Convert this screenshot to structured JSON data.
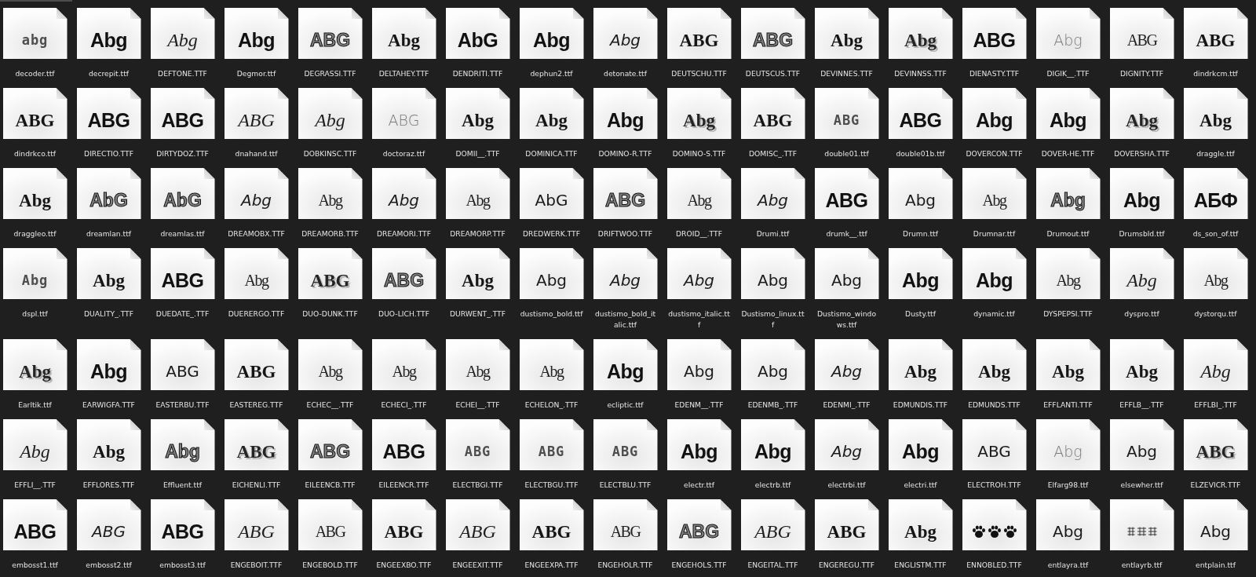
{
  "files": [
    {
      "name": "decoder.ttf",
      "preview": "abg",
      "kind": "dotted"
    },
    {
      "name": "decrepit.ttf",
      "preview": "Abg",
      "kind": "heavy"
    },
    {
      "name": "DEFTONE.TTF",
      "preview": "Abg",
      "kind": "script"
    },
    {
      "name": "Degmor.ttf",
      "preview": "Abg",
      "kind": "heavy"
    },
    {
      "name": "DEGRASSI.TTF",
      "preview": "ABG",
      "kind": "outline"
    },
    {
      "name": "DELTAHEY.TTF",
      "preview": "Abg",
      "kind": "serif"
    },
    {
      "name": "DENDRITI.TTF",
      "preview": "AbG",
      "kind": "heavy"
    },
    {
      "name": "dephun2.ttf",
      "preview": "Abg",
      "kind": "heavy"
    },
    {
      "name": "detonate.ttf",
      "preview": "Abg",
      "kind": "italic"
    },
    {
      "name": "DEUTSCHU.TTF",
      "preview": "ABG",
      "kind": "serif"
    },
    {
      "name": "DEUTSCUS.TTF",
      "preview": "ABG",
      "kind": "outline"
    },
    {
      "name": "DEVINNES.TTF",
      "preview": "Abg",
      "kind": "serif"
    },
    {
      "name": "DEVINNSS.TTF",
      "preview": "Abg",
      "kind": "shadow"
    },
    {
      "name": "DIENASTY.TTF",
      "preview": "ABG",
      "kind": "heavy"
    },
    {
      "name": "DIGIK__.TTF",
      "preview": "Abg",
      "kind": "light"
    },
    {
      "name": "DIGNITY.TTF",
      "preview": "ABG",
      "kind": "condensed"
    },
    {
      "name": "dindrkcm.ttf",
      "preview": "ABG",
      "kind": "serif"
    },
    {
      "name": "dindrkco.ttf",
      "preview": "ABG",
      "kind": "serif"
    },
    {
      "name": "DIRECTIO.TTF",
      "preview": "ABG",
      "kind": "heavy"
    },
    {
      "name": "DIRTYDOZ.TTF",
      "preview": "ABG",
      "kind": "heavy"
    },
    {
      "name": "dnahand.ttf",
      "preview": "ABG",
      "kind": "script"
    },
    {
      "name": "DOBKINSC.TTF",
      "preview": "Abg",
      "kind": "script"
    },
    {
      "name": "doctoraz.ttf",
      "preview": "ABG",
      "kind": "light"
    },
    {
      "name": "DOMII__.TTF",
      "preview": "Abg",
      "kind": "serif"
    },
    {
      "name": "DOMINICA.TTF",
      "preview": "Abg",
      "kind": "serif"
    },
    {
      "name": "DOMINO-R.TTF",
      "preview": "Abg",
      "kind": "heavy"
    },
    {
      "name": "DOMINO-S.TTF",
      "preview": "Abg",
      "kind": "shadow"
    },
    {
      "name": "DOMISC_.TTF",
      "preview": "ABG",
      "kind": "serif"
    },
    {
      "name": "double01.ttf",
      "preview": "ABG",
      "kind": "dotted"
    },
    {
      "name": "double01b.ttf",
      "preview": "ABG",
      "kind": "heavy"
    },
    {
      "name": "DOVERCON.TTF",
      "preview": "Abg",
      "kind": "heavy"
    },
    {
      "name": "DOVER-HE.TTF",
      "preview": "Abg",
      "kind": "heavy"
    },
    {
      "name": "DOVERSHA.TTF",
      "preview": "Abg",
      "kind": "shadow"
    },
    {
      "name": "draggle.ttf",
      "preview": "Abg",
      "kind": "serif"
    },
    {
      "name": "draggleo.ttf",
      "preview": "Abg",
      "kind": "serif"
    },
    {
      "name": "dreamlan.ttf",
      "preview": "AbG",
      "kind": "outline"
    },
    {
      "name": "dreamlas.ttf",
      "preview": "AbG",
      "kind": "outline"
    },
    {
      "name": "DREAMOBX.TTF",
      "preview": "Abg",
      "kind": "italic"
    },
    {
      "name": "DREAMORB.TTF",
      "preview": "Abg",
      "kind": "condensed"
    },
    {
      "name": "DREAMORI.TTF",
      "preview": "Abg",
      "kind": "italic"
    },
    {
      "name": "DREAMORP.TTF",
      "preview": "Abg",
      "kind": "condensed"
    },
    {
      "name": "DREDWERK.TTF",
      "preview": "AbG",
      "kind": "sans"
    },
    {
      "name": "DRIFTWOO.TTF",
      "preview": "ABG",
      "kind": "outline"
    },
    {
      "name": "DROID__.TTF",
      "preview": "Abg",
      "kind": "condensed"
    },
    {
      "name": "Drumi.ttf",
      "preview": "Abg",
      "kind": "italic"
    },
    {
      "name": "drumk__.ttf",
      "preview": "ABG",
      "kind": "heavy"
    },
    {
      "name": "Drumn.ttf",
      "preview": "Abg",
      "kind": "sans"
    },
    {
      "name": "Drumnar.ttf",
      "preview": "Abg",
      "kind": "condensed"
    },
    {
      "name": "Drumout.ttf",
      "preview": "Abg",
      "kind": "outline"
    },
    {
      "name": "Drumsbld.ttf",
      "preview": "Abg",
      "kind": "heavy"
    },
    {
      "name": "ds_son_of.ttf",
      "preview": "АБФ",
      "kind": "heavy"
    },
    {
      "name": "dspl.ttf",
      "preview": "Abg",
      "kind": "dotted"
    },
    {
      "name": "DUALITY_.TTF",
      "preview": "Abg",
      "kind": "serif"
    },
    {
      "name": "DUEDATE_.TTF",
      "preview": "ABG",
      "kind": "heavy"
    },
    {
      "name": "DUERERGO.TTF",
      "preview": "Abg",
      "kind": "condensed"
    },
    {
      "name": "DUO-DUNK.TTF",
      "preview": "ABG",
      "kind": "shadow"
    },
    {
      "name": "DUO-LICH.TTF",
      "preview": "ABG",
      "kind": "outline"
    },
    {
      "name": "DURWENT_.TTF",
      "preview": "Abg",
      "kind": "serif"
    },
    {
      "name": "dustismo_bold.ttf",
      "preview": "Abg",
      "kind": "sans"
    },
    {
      "name": "dustismo_bold_italic.ttf",
      "preview": "Abg",
      "kind": "italic"
    },
    {
      "name": "dustismo_italic.ttf",
      "preview": "Abg",
      "kind": "italic"
    },
    {
      "name": "Dustismo_linux.ttf",
      "preview": "Abg",
      "kind": "sans"
    },
    {
      "name": "Dustismo_windows.ttf",
      "preview": "Abg",
      "kind": "sans"
    },
    {
      "name": "Dusty.ttf",
      "preview": "Abg",
      "kind": "heavy"
    },
    {
      "name": "dynamic.ttf",
      "preview": "Abg",
      "kind": "heavy"
    },
    {
      "name": "DYSPEPSI.TTF",
      "preview": "Abg",
      "kind": "condensed"
    },
    {
      "name": "dyspro.ttf",
      "preview": "Abg",
      "kind": "script"
    },
    {
      "name": "dystorqu.ttf",
      "preview": "Abg",
      "kind": "condensed"
    },
    {
      "name": "Earltik.ttf",
      "preview": "Abg",
      "kind": "shadow"
    },
    {
      "name": "EARWIGFA.TTF",
      "preview": "Abg",
      "kind": "heavy"
    },
    {
      "name": "EASTERBU.TTF",
      "preview": "ABG",
      "kind": "sans"
    },
    {
      "name": "EASTEREG.TTF",
      "preview": "ABG",
      "kind": "serif"
    },
    {
      "name": "ECHEC__.TTF",
      "preview": "Abg",
      "kind": "condensed"
    },
    {
      "name": "ECHECI_.TTF",
      "preview": "Abg",
      "kind": "condensed"
    },
    {
      "name": "ECHEI__.TTF",
      "preview": "Abg",
      "kind": "condensed"
    },
    {
      "name": "ECHELON_.TTF",
      "preview": "Abg",
      "kind": "condensed"
    },
    {
      "name": "ecliptic.ttf",
      "preview": "Abg",
      "kind": "heavy"
    },
    {
      "name": "EDENM__.TTF",
      "preview": "Abg",
      "kind": "sans"
    },
    {
      "name": "EDENMB_.TTF",
      "preview": "Abg",
      "kind": "sans"
    },
    {
      "name": "EDENMI_.TTF",
      "preview": "Abg",
      "kind": "italic"
    },
    {
      "name": "EDMUNDIS.TTF",
      "preview": "Abg",
      "kind": "serif"
    },
    {
      "name": "EDMUNDS.TTF",
      "preview": "Abg",
      "kind": "serif"
    },
    {
      "name": "EFFLANTI.TTF",
      "preview": "Abg",
      "kind": "serif"
    },
    {
      "name": "EFFLB__.TTF",
      "preview": "Abg",
      "kind": "serif"
    },
    {
      "name": "EFFLBI_.TTF",
      "preview": "Abg",
      "kind": "script"
    },
    {
      "name": "EFFLI__.TTF",
      "preview": "Abg",
      "kind": "script"
    },
    {
      "name": "EFFLORES.TTF",
      "preview": "Abg",
      "kind": "serif"
    },
    {
      "name": "Effluent.ttf",
      "preview": "Abg",
      "kind": "outline"
    },
    {
      "name": "EICHENLI.TTF",
      "preview": "ABG",
      "kind": "shadow"
    },
    {
      "name": "EILEENCB.TTF",
      "preview": "ABG",
      "kind": "outline"
    },
    {
      "name": "EILEENCR.TTF",
      "preview": "ABG",
      "kind": "heavy"
    },
    {
      "name": "ELECTBGI.TTF",
      "preview": "ABG",
      "kind": "dotted"
    },
    {
      "name": "ELECTBGU.TTF",
      "preview": "ABG",
      "kind": "dotted"
    },
    {
      "name": "ELECTBLU.TTF",
      "preview": "ABG",
      "kind": "dotted"
    },
    {
      "name": "electr.ttf",
      "preview": "Abg",
      "kind": "heavy"
    },
    {
      "name": "electrb.ttf",
      "preview": "Abg",
      "kind": "heavy"
    },
    {
      "name": "electrbi.ttf",
      "preview": "Abg",
      "kind": "italic"
    },
    {
      "name": "electri.ttf",
      "preview": "Abg",
      "kind": "heavy"
    },
    {
      "name": "ELECTROH.TTF",
      "preview": "ABG",
      "kind": "sans"
    },
    {
      "name": "Elfarg98.ttf",
      "preview": "Abg",
      "kind": "light"
    },
    {
      "name": "elsewher.ttf",
      "preview": "Abg",
      "kind": "sans"
    },
    {
      "name": "ELZEVICR.TTF",
      "preview": "ABG",
      "kind": "shadow"
    },
    {
      "name": "embosst1.ttf",
      "preview": "ABG",
      "kind": "heavy"
    },
    {
      "name": "embosst2.ttf",
      "preview": "ABG",
      "kind": "italic"
    },
    {
      "name": "embosst3.ttf",
      "preview": "ABG",
      "kind": "heavy"
    },
    {
      "name": "ENGEBOIT.TTF",
      "preview": "ABG",
      "kind": "script"
    },
    {
      "name": "ENGEBOLD.TTF",
      "preview": "ABG",
      "kind": "condensed"
    },
    {
      "name": "ENGEEXBO.TTF",
      "preview": "ABG",
      "kind": "serif"
    },
    {
      "name": "ENGEEXIT.TTF",
      "preview": "ABG",
      "kind": "script"
    },
    {
      "name": "ENGEEXPA.TTF",
      "preview": "ABG",
      "kind": "serif"
    },
    {
      "name": "ENGEHOLR.TTF",
      "preview": "ABG",
      "kind": "condensed"
    },
    {
      "name": "ENGEHOLS.TTF",
      "preview": "ABG",
      "kind": "outline"
    },
    {
      "name": "ENGEITAL.TTF",
      "preview": "ABG",
      "kind": "script"
    },
    {
      "name": "ENGEREGU.TTF",
      "preview": "ABG",
      "kind": "serif"
    },
    {
      "name": "ENGLISTM.TTF",
      "preview": "Abg",
      "kind": "serif"
    },
    {
      "name": "ENNOBLED.TTF",
      "kind": "paws"
    },
    {
      "name": "entlayra.ttf",
      "preview": "Abg",
      "kind": "sans"
    },
    {
      "name": "entlayrb.ttf",
      "kind": "symbols"
    },
    {
      "name": "entplain.ttf",
      "preview": "Abg",
      "kind": "sans"
    }
  ]
}
